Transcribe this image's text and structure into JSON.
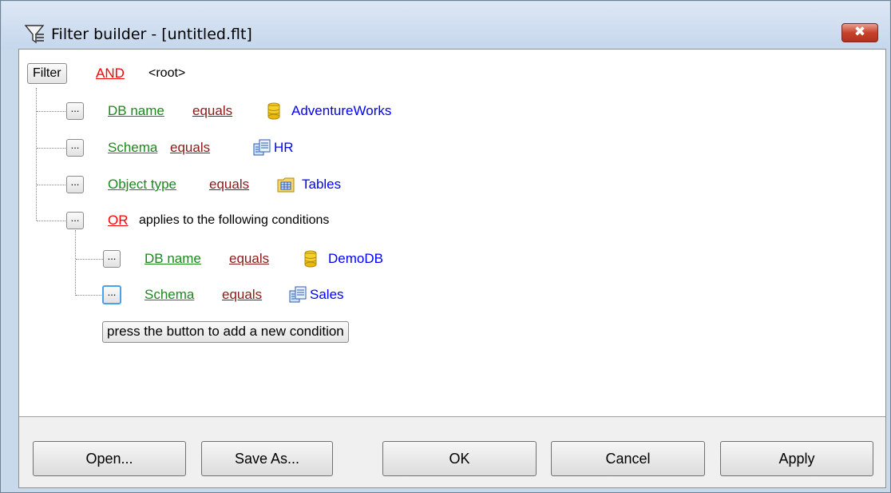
{
  "window": {
    "title": "Filter builder - [untitled.flt]",
    "close_glyph": "✖"
  },
  "tree": {
    "root_button": "Filter",
    "root_operator": "AND",
    "root_label": "<root>",
    "dots": "...",
    "conditions": [
      {
        "field": "DB name",
        "op": "equals",
        "icon": "database-icon",
        "value": "AdventureWorks"
      },
      {
        "field": "Schema",
        "op": "equals",
        "icon": "schema-icon",
        "value": "HR"
      },
      {
        "field": "Object type",
        "op": "equals",
        "icon": "tables-icon",
        "value": "Tables"
      }
    ],
    "group": {
      "operator": "OR",
      "label": "applies to the following conditions",
      "conditions": [
        {
          "field": "DB name",
          "op": "equals",
          "icon": "database-icon",
          "value": "DemoDB"
        },
        {
          "field": "Schema",
          "op": "equals",
          "icon": "schema-icon",
          "value": "Sales"
        }
      ]
    },
    "add_condition_button": "press the button to add a new condition"
  },
  "footer": {
    "open": "Open...",
    "save_as": "Save As...",
    "ok": "OK",
    "cancel": "Cancel",
    "apply": "Apply"
  },
  "colors": {
    "field": "#1b8a1b",
    "operator": "#8b1a1a",
    "group_operator": "#ff0000",
    "value": "#0000ff"
  }
}
